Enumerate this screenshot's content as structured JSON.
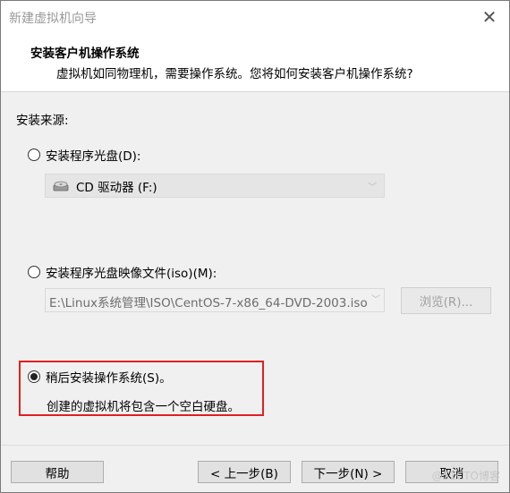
{
  "window": {
    "title": "新建虚拟机向导"
  },
  "header": {
    "title": "安装客户机操作系统",
    "subtitle": "虚拟机如同物理机，需要操作系统。您将如何安装客户机操作系统?"
  },
  "source": {
    "label": "安装来源:",
    "options": [
      {
        "label": "安装程序光盘(D):",
        "selected": false
      },
      {
        "label": "安装程序光盘映像文件(iso)(M):",
        "selected": false
      },
      {
        "label": "稍后安装操作系统(S)。",
        "selected": true
      }
    ],
    "cd_drive_value": "CD 驱动器 (F:)",
    "iso_path_value": "E:\\Linux系统管理\\ISO\\CentOS-7-x86_64-DVD-2003.iso",
    "browse_label": "浏览(R)...",
    "later_description": "创建的虚拟机将包含一个空白硬盘。"
  },
  "footer": {
    "help_label": "帮助",
    "back_label": "< 上一步(B)",
    "next_label": "下一步(N) >",
    "cancel_label": "取消"
  },
  "watermark": "@51CTO博客"
}
